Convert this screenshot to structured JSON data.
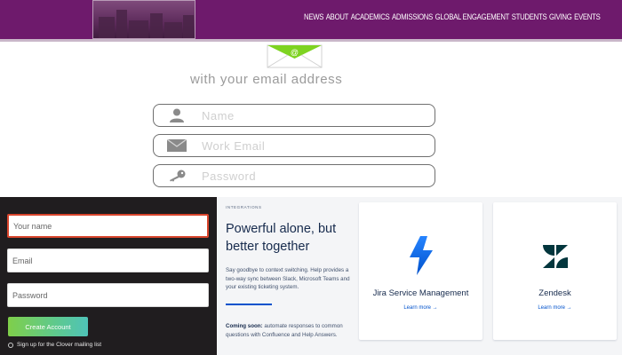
{
  "nav": {
    "items": [
      "NEWS",
      "ABOUT",
      "ACADEMICS",
      "ADMISSIONS",
      "GLOBAL ENGAGEMENT",
      "STUDENTS",
      "GIVING",
      "EVENTS"
    ]
  },
  "email_signup": {
    "tagline": "with your email address",
    "icon": "email-at-icon",
    "fields": {
      "name_placeholder": "Name",
      "work_email_placeholder": "Work Email",
      "password_placeholder": "Password"
    }
  },
  "dark_form": {
    "name_placeholder": "Your name",
    "email_placeholder": "Email",
    "password_placeholder": "Password",
    "create_label": "Create Account",
    "mailing_label": "Sign up for the Clover mailing list"
  },
  "integrations": {
    "overline": "INTEGRATIONS",
    "headline": "Powerful alone, but better together",
    "description": "Say goodbye to context switching. Help provides a two-way sync between Slack, Microsoft Teams and your existing ticketing system.",
    "coming_soon_label": "Coming soon:",
    "coming_soon_text": " automate responses to common questions with Confluence and Help Answers.",
    "cards": [
      {
        "title": "Jira Service Management",
        "link": "Learn more →",
        "icon": "bolt-icon"
      },
      {
        "title": "Zendesk",
        "link": "Learn more →",
        "icon": "zendesk-icon"
      }
    ]
  },
  "colors": {
    "topbar": "#6e1a6c",
    "envelope": "#7ed321",
    "dark_panel": "#201d1f",
    "accent_blue": "#0052cc",
    "active_input_border": "#d8452c"
  }
}
